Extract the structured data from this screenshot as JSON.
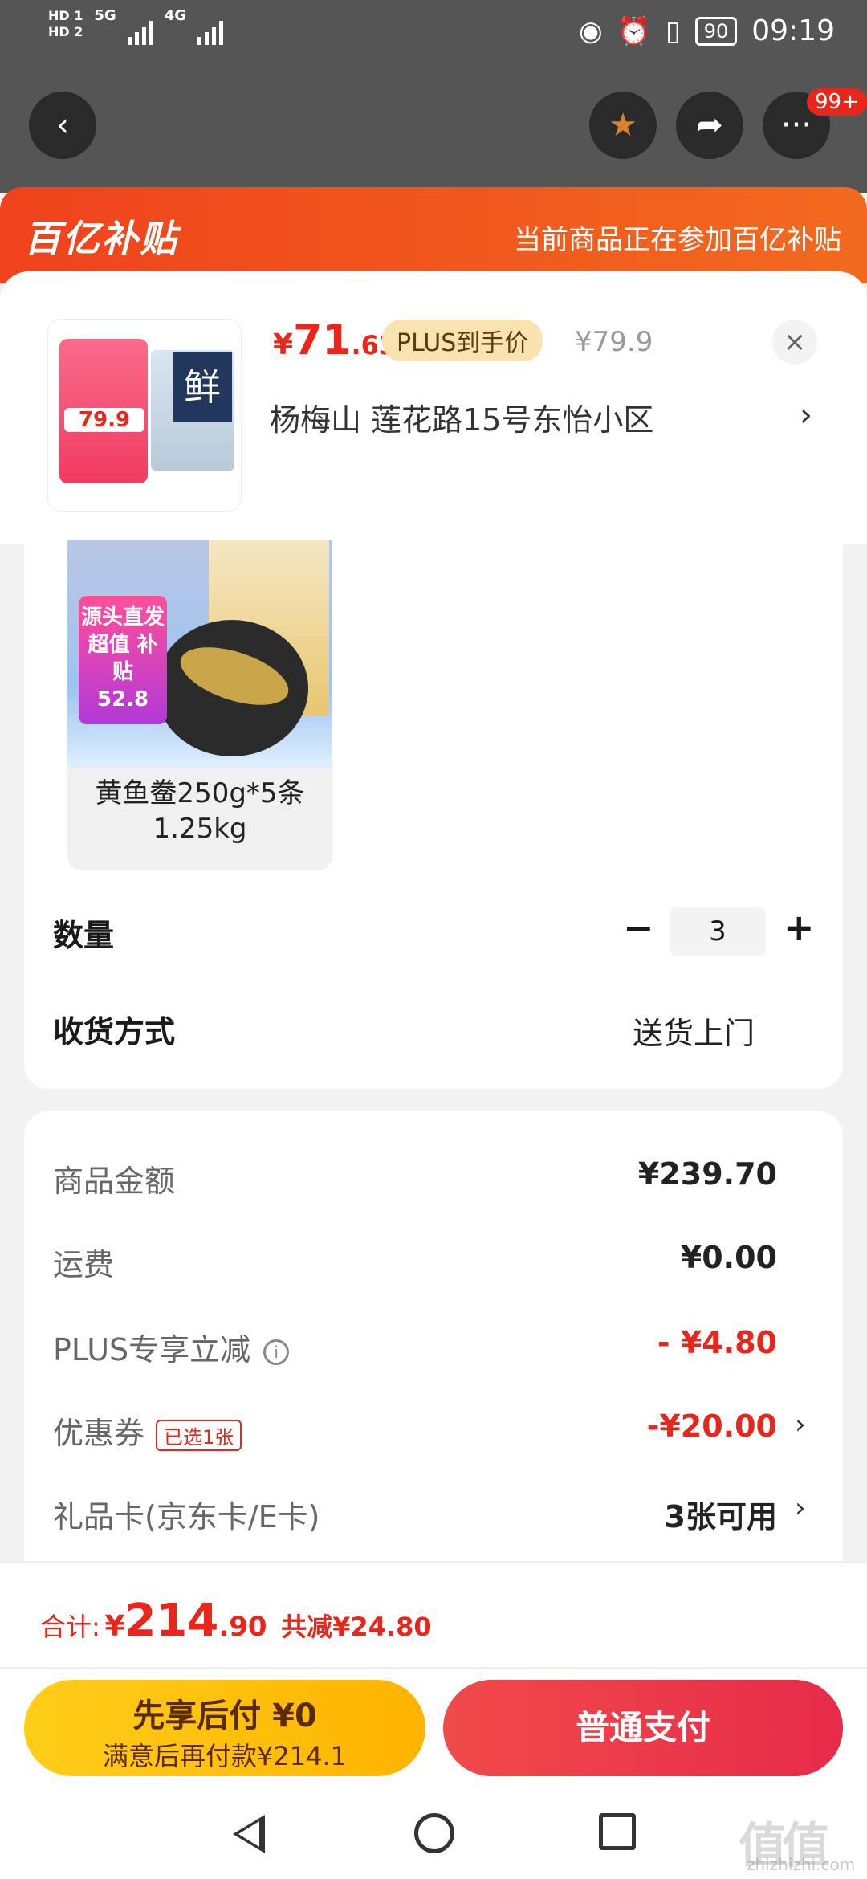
{
  "status_bar": {
    "hd1": "HD 1",
    "hd2": "HD 2",
    "net1": "5G",
    "net2": "4G",
    "battery": "90",
    "time": "09:19"
  },
  "top_nav": {
    "badge": "99+"
  },
  "banner": {
    "logo": "百亿补贴",
    "text": "当前商品正在参加百亿补贴"
  },
  "product": {
    "thumb_price": "79.9",
    "thumb_pack_char": "鲜",
    "price_yen": "¥",
    "price_int": "71",
    "price_dec": ".63",
    "plus_tag": "PLUS到手价",
    "orig_price": "¥79.9",
    "close": "×",
    "address": "杨梅山  莲花路15号东怡小区",
    "address_chevron": "›"
  },
  "variant": {
    "promo": "源头直发 超值 补贴",
    "price": "52.8",
    "label": "黄鱼鲞250g*5条 1.25kg"
  },
  "quantity": {
    "label": "数量",
    "minus": "−",
    "value": "3",
    "plus": "+"
  },
  "shipping": {
    "label": "收货方式",
    "value": "送货上门"
  },
  "price_rows": {
    "goods_label": "商品金额",
    "goods_value": "¥239.70",
    "freight_label": "运费",
    "freight_value": "¥0.00",
    "plus_label": "PLUS专享立减",
    "plus_value": "- ¥4.80",
    "coupon_label": "优惠券",
    "coupon_tag": "已选1张",
    "coupon_value": "-¥20.00",
    "giftcard_label": "礼品卡(京东卡/E卡)",
    "giftcard_value": "3张可用",
    "chevron": "›"
  },
  "total": {
    "label": "合计:",
    "yen": "¥",
    "int": "214",
    "dec": ".90",
    "save": "共减¥24.80"
  },
  "buttons": {
    "pay_later_title": "先享后付 ¥0",
    "pay_later_sub": "满意后再付款¥214.1",
    "pay_normal": "普通支付"
  },
  "watermark": {
    "main": "值值值",
    "sub": "zhizhizhi.com"
  },
  "colors": {
    "accent_red": "#e8261c",
    "banner_orange": "#f0421c",
    "yellow_button": "#ffcd19"
  }
}
